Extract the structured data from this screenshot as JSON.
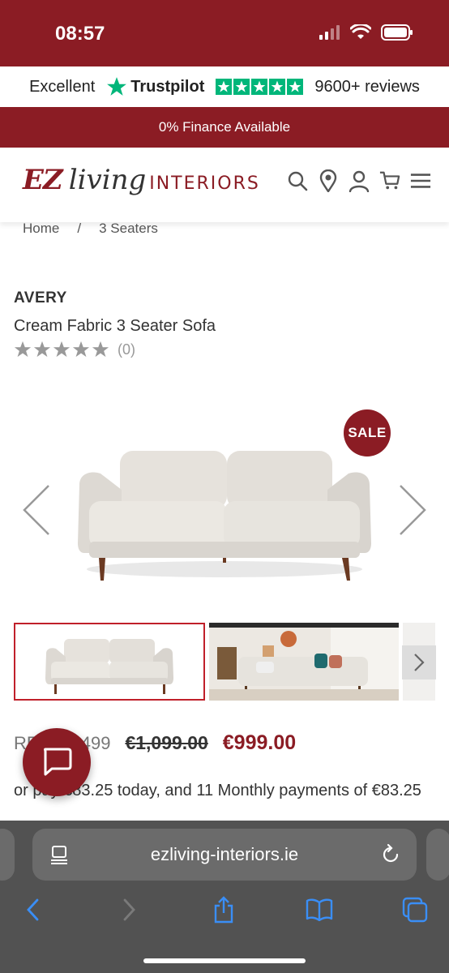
{
  "status": {
    "time": "08:57"
  },
  "trust": {
    "rating_word": "Excellent",
    "brand": "Trustpilot",
    "reviews": "9600+ reviews",
    "star_color": "#00b67a"
  },
  "finance_banner": "0% Finance Available",
  "logo": {
    "ez": "EZ",
    "living": "living",
    "interiors": "INTERIORS"
  },
  "header_icons": [
    "search-icon",
    "location-icon",
    "account-icon",
    "cart-icon",
    "menu-icon"
  ],
  "breadcrumb": {
    "home": "Home",
    "separator": "/",
    "current": "3 Seaters"
  },
  "product": {
    "brand": "AVERY",
    "title": "Cream Fabric 3 Seater Sofa",
    "review_count": "(0)",
    "stars": 0,
    "sale_badge": "SALE",
    "rrp": "RRP €1,499",
    "old_price": "€1,099.00",
    "price": "€999.00",
    "finance_text": "or pay €83.25 today, and 11 Monthly payments of €83.25"
  },
  "browser": {
    "url": "ezliving-interiors.ie"
  },
  "colors": {
    "brand": "#8b1c24",
    "accent_red": "#c0202a"
  }
}
